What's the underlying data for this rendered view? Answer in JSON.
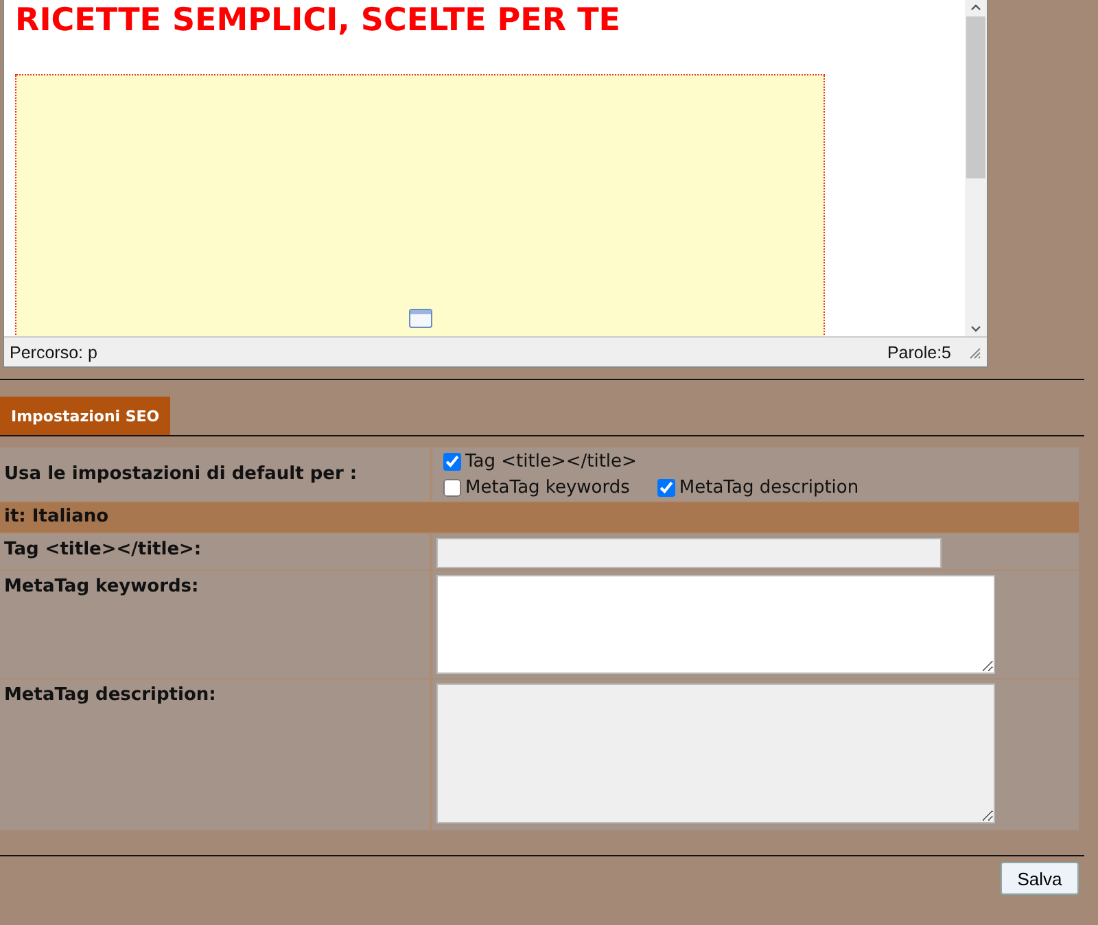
{
  "editor": {
    "heading": "RICETTE SEMPLICI, SCELTE PER TE",
    "path": "Percorso: p",
    "word_count": "Parole:5"
  },
  "tab": {
    "label": "Impostazioni SEO",
    "selected": true
  },
  "defaults": {
    "label": "Usa le impostazioni di default per :",
    "options": [
      {
        "label": "Tag <title></title>",
        "checked": true
      },
      {
        "label": "MetaTag keywords",
        "checked": false
      },
      {
        "label": "MetaTag description",
        "checked": true
      }
    ]
  },
  "language": "it: Italiano",
  "fields": [
    {
      "kind": "input",
      "label": "Tag <title></title>:",
      "disabled": true
    },
    {
      "kind": "textarea",
      "label": "MetaTag keywords:",
      "disabled": false
    },
    {
      "kind": "textarea",
      "label": "MetaTag description:",
      "disabled": true
    }
  ],
  "save_button": "Salva"
}
